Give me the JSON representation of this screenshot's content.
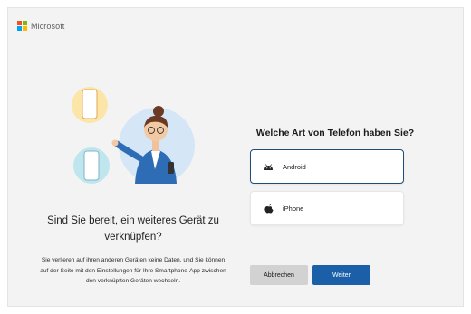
{
  "brand": {
    "name": "Microsoft"
  },
  "left": {
    "title": "Sind Sie bereit, ein weiteres Gerät zu verknüpfen?",
    "description": "Sie verlieren auf ihren anderen Geräten keine Daten, und Sie können auf der Seite mit den Einstellungen für Ihre Smartphone-App zwischen den verknüpften Geräten wechseln."
  },
  "question": {
    "title": "Welche Art von Telefon haben Sie?"
  },
  "options": [
    {
      "label": "Android",
      "icon": "android-icon",
      "selected": true
    },
    {
      "label": "iPhone",
      "icon": "apple-icon",
      "selected": false
    }
  ],
  "buttons": {
    "cancel": "Abbrechen",
    "next": "Weiter"
  },
  "colors": {
    "accent": "#1a5fa8",
    "selected_border": "#1f4e79",
    "logo_red": "#f25022",
    "logo_green": "#7fba00",
    "logo_blue": "#00a4ef",
    "logo_yellow": "#ffb900"
  }
}
